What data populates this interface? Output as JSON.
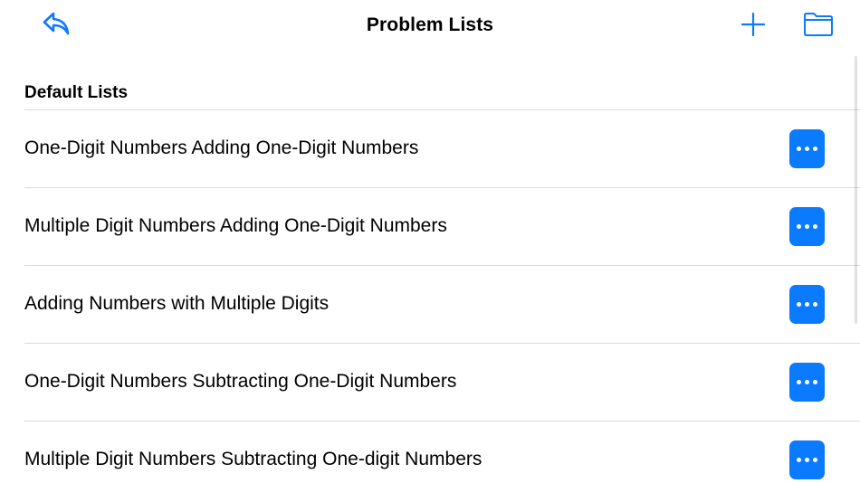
{
  "nav": {
    "title": "Problem Lists",
    "back_icon": "reply-arrow-icon",
    "add_icon": "plus-icon",
    "folder_icon": "folder-icon"
  },
  "section": {
    "header": "Default Lists"
  },
  "items": [
    {
      "label": "One-Digit Numbers Adding One-Digit Numbers",
      "action_icon": "ellipsis-icon"
    },
    {
      "label": "Multiple Digit Numbers Adding One-Digit Numbers",
      "action_icon": "ellipsis-icon"
    },
    {
      "label": "Adding Numbers with Multiple Digits",
      "action_icon": "ellipsis-icon"
    },
    {
      "label": "One-Digit Numbers Subtracting One-Digit Numbers",
      "action_icon": "ellipsis-icon"
    },
    {
      "label": "Multiple Digit Numbers Subtracting One-digit Numbers",
      "action_icon": "ellipsis-icon"
    }
  ],
  "colors": {
    "accent": "#0a7aff",
    "separator": "#dcdcdf",
    "text": "#000000",
    "background": "#ffffff"
  }
}
